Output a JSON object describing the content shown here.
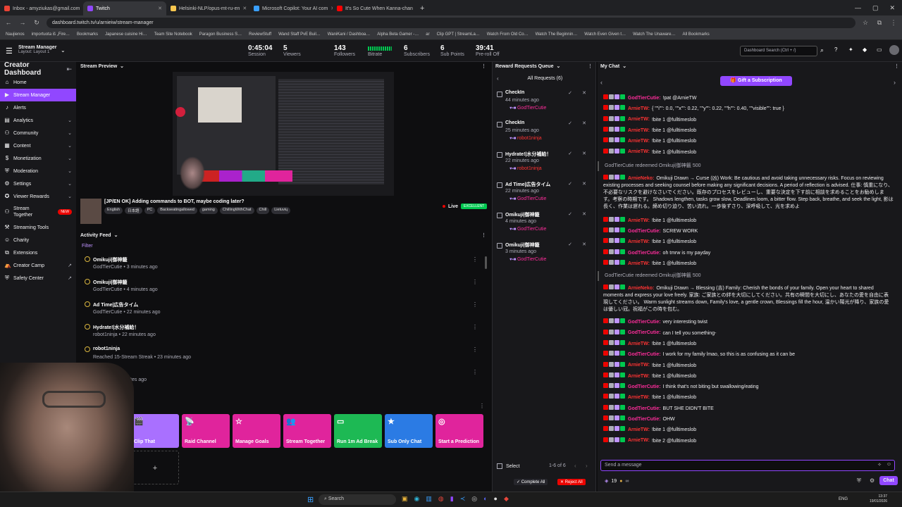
{
  "browser": {
    "tabs": [
      {
        "label": "Inbox - amyziukas@gmail.com",
        "color": "#ea4335"
      },
      {
        "label": "Twitch",
        "color": "#9147ff"
      },
      {
        "label": "Helsinki-NLP/opus-mt-ru-en",
        "color": "#f9c74f"
      },
      {
        "label": "Microsoft Copilot: Your AI com",
        "color": "#3aa0ff"
      },
      {
        "label": "It's So Cute When Kanna-chan",
        "color": "#ff0000"
      }
    ],
    "url": "dashboard.twitch.tv/u/arnieiw/stream-manager",
    "bookmarks": [
      "Naujienos",
      "importuota iš „Fire…",
      "Bookmarks",
      "Japanese cuisine Hi…",
      "Team Site Notebook",
      "Paragon Business S…",
      "ReviewStuff",
      "Wand Staff PvE Buil…",
      "WaniKani / Dashboa…",
      "Alpha Beta Gamer -…",
      "ar",
      "Clip GPT | StreamLa…",
      "Watch From Old Co…",
      "Watch The Beginnin…",
      "Watch Even Given t…",
      "Watch The Unaware…",
      "All Bookmarks"
    ]
  },
  "topbar": {
    "title": "Stream Manager",
    "layout": "Layout: Layout 1",
    "stats": [
      {
        "value": "0:45:04",
        "label": "Session"
      },
      {
        "value": "5",
        "label": "Viewers"
      },
      {
        "value": "143",
        "label": "Followers"
      },
      {
        "value": "",
        "label": "Bitrate"
      },
      {
        "value": "6",
        "label": "Subscribers"
      },
      {
        "value": "6",
        "label": "Sub Points"
      },
      {
        "value": "39:41",
        "label": "Pre-roll Off"
      }
    ],
    "search_placeholder": "Dashboard Search (Ctrl + /)"
  },
  "sidebar": {
    "title": "Creator Dashboard",
    "items": [
      {
        "label": "Home",
        "icon": "home-icon",
        "chev": ""
      },
      {
        "label": "Stream Manager",
        "icon": "stream-icon",
        "chev": ""
      },
      {
        "label": "Alerts",
        "icon": "bell-icon",
        "chev": ""
      },
      {
        "label": "Analytics",
        "icon": "chart-icon",
        "chev": "⌄"
      },
      {
        "label": "Community",
        "icon": "people-icon",
        "chev": "⌄"
      },
      {
        "label": "Content",
        "icon": "content-icon",
        "chev": "⌄"
      },
      {
        "label": "Monetization",
        "icon": "money-icon",
        "chev": "⌄"
      },
      {
        "label": "Moderation",
        "icon": "shield-icon",
        "chev": "⌄"
      },
      {
        "label": "Settings",
        "icon": "gear-icon",
        "chev": "⌄"
      },
      {
        "label": "Viewer Rewards",
        "icon": "reward-icon",
        "chev": "⌄"
      }
    ],
    "stream_together": {
      "label1": "Stream",
      "label2": "Together",
      "badge": "NEW"
    },
    "extra": [
      "Streaming Tools",
      "Charity",
      "Extensions",
      "Creator Camp",
      "Safety Center"
    ]
  },
  "preview": {
    "title": "Stream Preview",
    "stream_title": "[JP/EN OK] Adding commands to BOT, maybe coding later?",
    "tags": [
      "English",
      "日本語",
      "PC",
      "Backseatingallowed",
      "gaming",
      "ChillingWithChat",
      "Chill",
      "Lietuvių"
    ],
    "live": "Live",
    "quality": "EXCELLENT"
  },
  "activity": {
    "title": "Activity Feed",
    "filter": "Filter",
    "items": [
      {
        "title": "Omikuji|御神籤",
        "sub": "GodTierCutie • 3 minutes ago"
      },
      {
        "title": "Omikuji|御神籤",
        "sub": "GodTierCutie • 4 minutes ago"
      },
      {
        "title": "Ad Time|広告タイム",
        "sub": "GodTierCutie • 22 minutes ago"
      },
      {
        "title": "Hydrate!|水分補給！",
        "sub": "robot1ninja • 22 minutes ago"
      },
      {
        "title": "robot1ninja",
        "sub": "Reached 15-Stream Streak • 23 minutes ago"
      },
      {
        "title": "CheckIn",
        "sub": "…ninja • 25 minutes ago"
      }
    ]
  },
  "quick_actions": [
    {
      "label": "Clip That",
      "color": "#a970ff",
      "icon": "🎬"
    },
    {
      "label": "Raid Channel",
      "color": "#e0249c",
      "icon": "📡"
    },
    {
      "label": "Manage Goals",
      "color": "#e0249c",
      "icon": "☆"
    },
    {
      "label": "Stream Together",
      "color": "#e0249c",
      "icon": "👥"
    },
    {
      "label": "Run 1m Ad Break",
      "color": "#1db954",
      "icon": "▭"
    },
    {
      "label": "Sub Only Chat",
      "color": "#2b7be4",
      "icon": "★"
    },
    {
      "label": "Start a Prediction",
      "color": "#e0249c",
      "icon": "◎"
    }
  ],
  "reward": {
    "title": "Reward Requests Queue",
    "all": "All Requests (6)",
    "items": [
      {
        "title": "CheckIn",
        "time": "44 minutes ago",
        "user": "GodTierCutie",
        "ucolor": "#ff2d9b"
      },
      {
        "title": "CheckIn",
        "time": "25 minutes ago",
        "user": "robot1ninja",
        "ucolor": "#ff3333"
      },
      {
        "title": "Hydrate!|水分補給！",
        "time": "22 minutes ago",
        "user": "robot1ninja",
        "ucolor": "#ff3333"
      },
      {
        "title": "Ad Time|広告タイム",
        "time": "22 minutes ago",
        "user": "GodTierCutie",
        "ucolor": "#ff2d9b"
      },
      {
        "title": "Omikuji|御神籤",
        "time": "4 minutes ago",
        "user": "GodTierCutie",
        "ucolor": "#ff2d9b"
      },
      {
        "title": "Omikuji|御神籤",
        "time": "3 minutes ago",
        "user": "GodTierCutie",
        "ucolor": "#ff2d9b"
      }
    ],
    "select": "Select",
    "range": "1-6 of 6",
    "complete": "Complete All",
    "reject": "Reject All"
  },
  "chat": {
    "title": "My Chat",
    "gift": "Gift a Subscription",
    "messages": [
      {
        "user": "GodTierCutie:",
        "ucolor": "#ff2d9b",
        "text": "!pat @ArnieTW"
      },
      {
        "user": "ArnieTW:",
        "ucolor": "#ff3333",
        "text": "{ \"\"i\"\": 0.0, \"\"x\"\": 0.22, \"\"y\"\": 0.22, \"\"h\"\": 0.40, \"\"visible\"\": true }"
      },
      {
        "user": "ArnieTW:",
        "ucolor": "#ff3333",
        "text": "!bite 1 @fulltimeslob"
      },
      {
        "user": "ArnieTW:",
        "ucolor": "#ff3333",
        "text": "!bite 1 @fulltimeslob"
      },
      {
        "user": "ArnieTW:",
        "ucolor": "#ff3333",
        "text": "!bite 1 @fulltimeslob"
      },
      {
        "user": "ArnieTW:",
        "ucolor": "#ff3333",
        "text": "!bite 1 @fulltimeslob"
      }
    ],
    "system1": "GodTierCutie redeemed Omikuji|御神籤  500",
    "omikuji1_user": "ArnieNeko:",
    "omikuji1": "Omikuji Drawn → Curse (凶) Work: Be cautious and avoid taking unnecessary risks. Focus on reviewing existing processes and seeking counsel before making any significant decisions. A period of reflection is advised. 仕事: 慎重になり、不必要なリスクを避けなさいでください。既存のプロセスをレビューし、重要な決定を下す前に相談を求めることをお勧めします。考察の時期です。 Shadows lengthen, tasks grow slow, Deadlines loom, a bitter flow. Step back, breathe, and seek the light, 影は長く、作業は遅れる。締め切り迫り、苦い流れ。一歩後ずさり、深呼吸して、光を求めよ",
    "messages2": [
      {
        "user": "ArnieTW:",
        "ucolor": "#ff3333",
        "text": "!bite 1 @fulltimeslob"
      },
      {
        "user": "GodTierCutie:",
        "ucolor": "#ff2d9b",
        "text": "SCREW WORK"
      },
      {
        "user": "ArnieTW:",
        "ucolor": "#ff3333",
        "text": "!bite 1 @fulltimeslob"
      },
      {
        "user": "GodTierCutie:",
        "ucolor": "#ff2d9b",
        "text": "oh tmrw is my payday"
      },
      {
        "user": "ArnieTW:",
        "ucolor": "#ff3333",
        "text": "!bite 1 @fulltimeslob"
      }
    ],
    "system2": "GodTierCutie redeemed Omikuji|御神籤  500",
    "omikuji2_user": "ArnieNeko:",
    "omikuji2": "Omikuji Drawn → Blessing (吉) Family: Cherish the bonds of your family. Open your heart to shared moments and express your love freely. 家族: ご家族との絆を大切にしてください。共有の瞬間を大切にし、あなたの愛を自由に表現してください。 Warm sunlight streams down, Family's love, a gentle crown, Blessings fill the hour, 温かい陽光が降り、家族の愛は優しい冠。祝福がこの時を包む。",
    "messages3": [
      {
        "user": "GodTierCutie:",
        "ucolor": "#ff2d9b",
        "text": "very interesting twist"
      },
      {
        "user": "GodTierCutie:",
        "ucolor": "#ff2d9b",
        "text": "can I tell you something-"
      },
      {
        "user": "ArnieTW:",
        "ucolor": "#ff3333",
        "text": "!bite 1 @fulltimeslob"
      },
      {
        "user": "GodTierCutie:",
        "ucolor": "#ff2d9b",
        "text": "I work for my family lmao, so this is as confusing as it can be"
      },
      {
        "user": "ArnieTW:",
        "ucolor": "#ff3333",
        "text": "!bite 1 @fulltimeslob"
      },
      {
        "user": "ArnieTW:",
        "ucolor": "#ff3333",
        "text": "!bite 1 @fulltimeslob"
      },
      {
        "user": "GodTierCutie:",
        "ucolor": "#ff2d9b",
        "text": "I think that's not biting but swallowing/eating"
      },
      {
        "user": "ArnieTW:",
        "ucolor": "#ff3333",
        "text": "!bite 1 @fulltimeslob"
      },
      {
        "user": "GodTierCutie:",
        "ucolor": "#ff2d9b",
        "text": "BUT SHE DIDN'T BITE"
      },
      {
        "user": "GodTierCutie:",
        "ucolor": "#ff2d9b",
        "text": "OHW"
      },
      {
        "user": "ArnieTW:",
        "ucolor": "#ff3333",
        "text": "!bite 1 @fulltimeslob"
      },
      {
        "user": "ArnieTW:",
        "ucolor": "#ff3333",
        "text": "!bite 2 @fulltimeslob"
      }
    ],
    "input_placeholder": "Send a message",
    "points": "19",
    "chat_btn": "Chat"
  },
  "taskbar": {
    "search": "Search",
    "lang": "ENG",
    "time": "13:37",
    "date": "19/01/2026"
  }
}
